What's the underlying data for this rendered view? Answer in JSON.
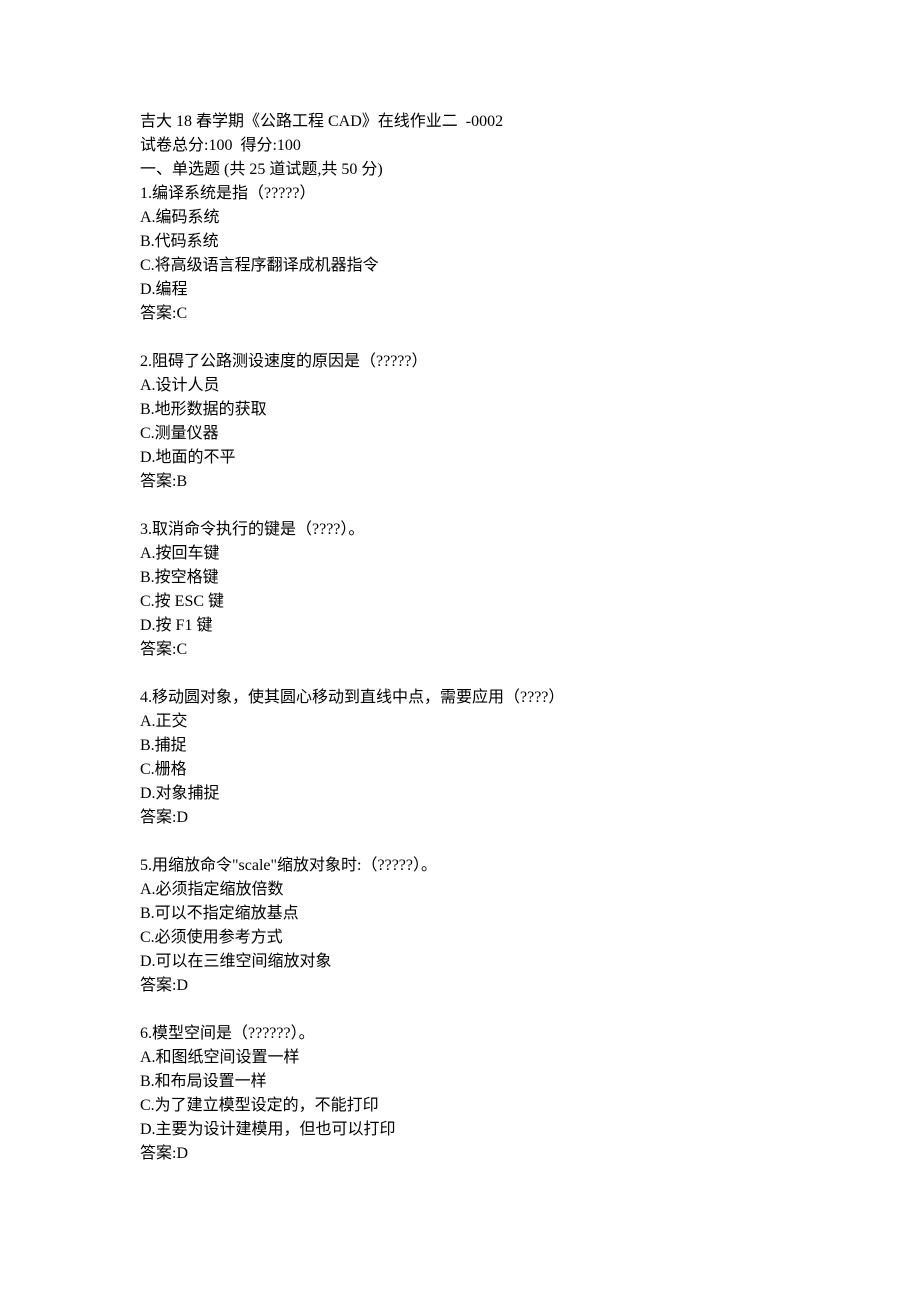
{
  "header": {
    "title": "吉大 18 春学期《公路工程 CAD》在线作业二  -0002",
    "score_line": "试卷总分:100  得分:100",
    "section_line": "一、单选题 (共 25 道试题,共 50 分)"
  },
  "questions": [
    {
      "stem": "1.编译系统是指（?????）",
      "options": [
        "A.编码系统",
        "B.代码系统",
        "C.将高级语言程序翻译成机器指令",
        "D.编程"
      ],
      "answer": "答案:C"
    },
    {
      "stem": "2.阻碍了公路测设速度的原因是（?????）",
      "options": [
        "A.设计人员",
        "B.地形数据的获取",
        "C.测量仪器",
        "D.地面的不平"
      ],
      "answer": "答案:B"
    },
    {
      "stem": "3.取消命令执行的键是（????）。",
      "options": [
        "A.按回车键",
        "B.按空格键",
        "C.按 ESC 键",
        "D.按 F1 键"
      ],
      "answer": "答案:C"
    },
    {
      "stem": "4.移动圆对象，使其圆心移动到直线中点，需要应用（????）",
      "options": [
        "A.正交",
        "B.捕捉",
        "C.栅格",
        "D.对象捕捉"
      ],
      "answer": "答案:D"
    },
    {
      "stem": "5.用缩放命令\"scale\"缩放对象时:（?????）。",
      "options": [
        "A.必须指定缩放倍数",
        "B.可以不指定缩放基点",
        "C.必须使用参考方式",
        "D.可以在三维空间缩放对象"
      ],
      "answer": "答案:D"
    },
    {
      "stem": "6.模型空间是（??????）。",
      "options": [
        "A.和图纸空间设置一样",
        "B.和布局设置一样",
        "C.为了建立模型设定的，不能打印",
        "D.主要为设计建模用，但也可以打印"
      ],
      "answer": "答案:D"
    }
  ]
}
